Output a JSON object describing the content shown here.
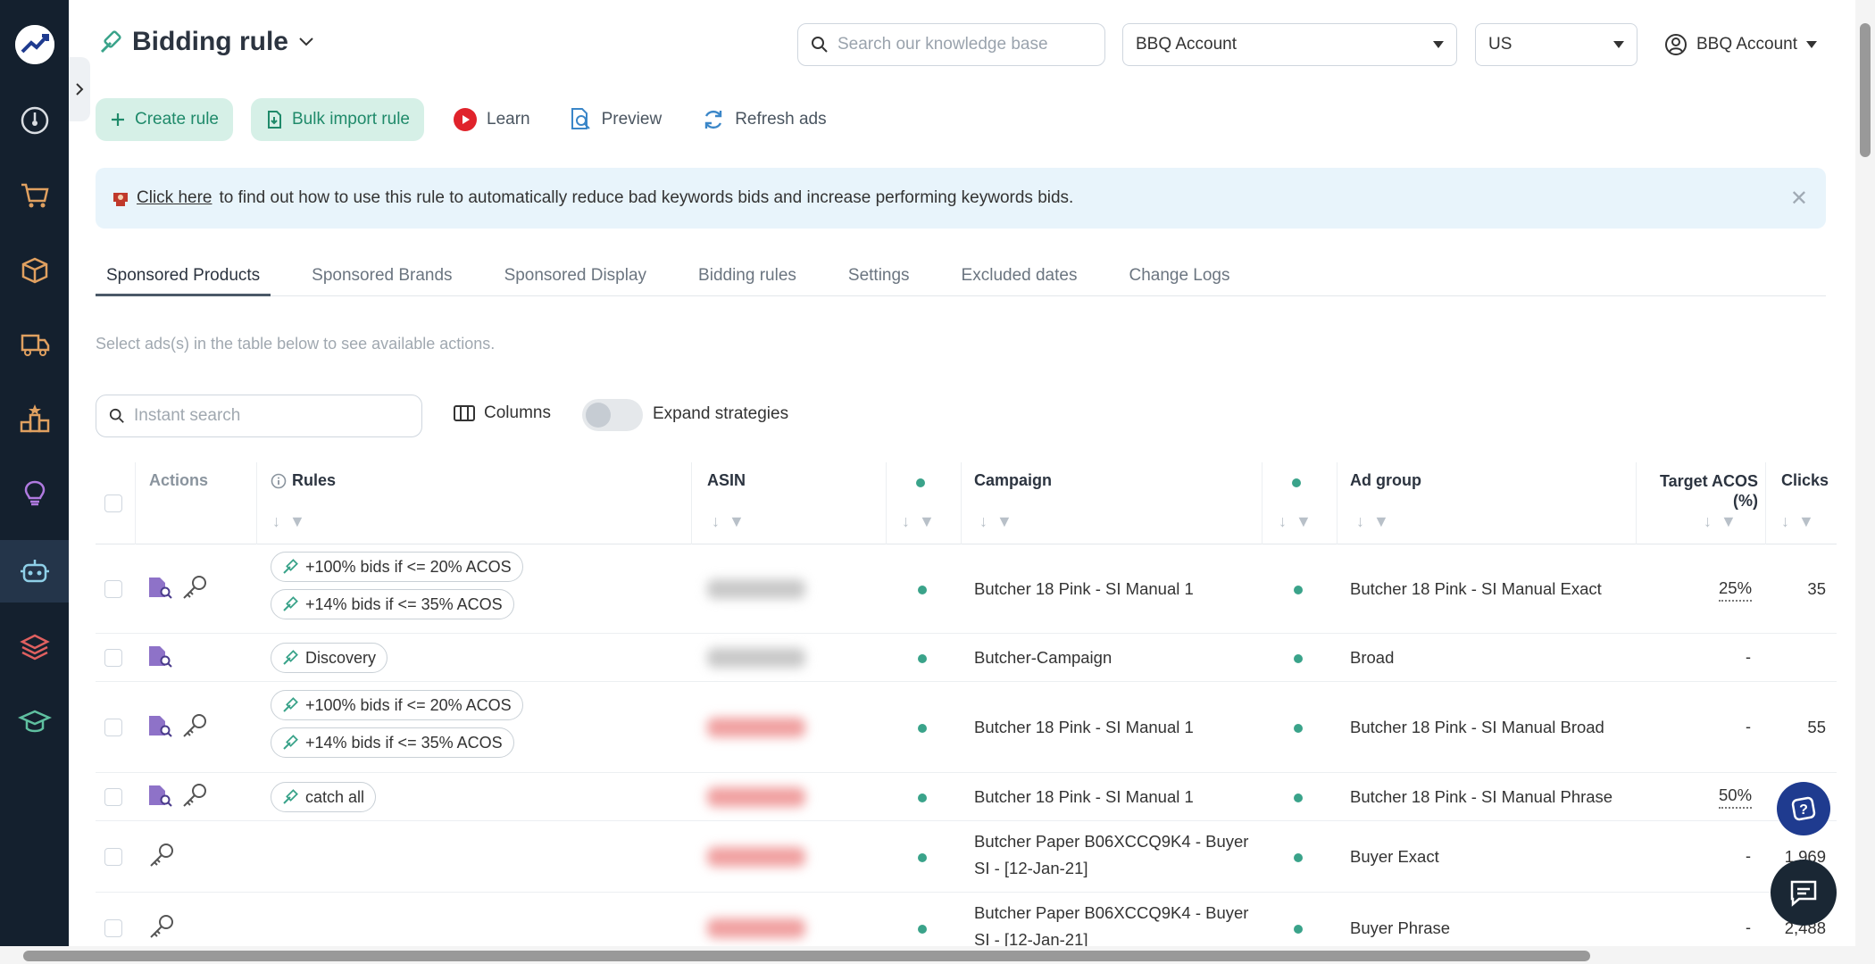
{
  "header": {
    "title": "Bidding rule",
    "kb_search_placeholder": "Search our knowledge base",
    "account_select": "BBQ Account",
    "region_select": "US",
    "account_menu": "BBQ Account"
  },
  "toolbar": {
    "create_rule": "Create rule",
    "bulk_import": "Bulk import rule",
    "learn": "Learn",
    "preview": "Preview",
    "refresh": "Refresh ads"
  },
  "banner": {
    "link_text": "Click here",
    "text": "to find out how to use this rule to automatically reduce bad keywords bids and increase performing keywords bids."
  },
  "tabs": [
    "Sponsored Products",
    "Sponsored Brands",
    "Sponsored Display",
    "Bidding rules",
    "Settings",
    "Excluded dates",
    "Change Logs"
  ],
  "hint": "Select ads(s) in the table below to see available actions.",
  "filter": {
    "instant_search_placeholder": "Instant search",
    "columns": "Columns",
    "expand_strategies": "Expand strategies"
  },
  "table": {
    "headers": {
      "actions": "Actions",
      "rules": "Rules",
      "asin": "ASIN",
      "campaign": "Campaign",
      "ad_group": "Ad group",
      "target_acos": "Target ACOS (%)",
      "clicks": "Clicks"
    },
    "rows": [
      {
        "rules": [
          "+100% bids if <= 20% ACOS",
          "+14% bids if <= 35% ACOS"
        ],
        "campaign": "Butcher 18 Pink - SI Manual 1",
        "ad_group": "Butcher 18 Pink - SI Manual Exact",
        "acos": "25%",
        "clicks": "35"
      },
      {
        "rules": [
          "Discovery"
        ],
        "campaign": "Butcher-Campaign",
        "ad_group": "Broad",
        "acos": "-",
        "clicks": ""
      },
      {
        "rules": [
          "+100% bids if <= 20% ACOS",
          "+14% bids if <= 35% ACOS"
        ],
        "campaign": "Butcher 18 Pink - SI Manual 1",
        "ad_group": "Butcher 18 Pink - SI Manual Broad",
        "acos": "-",
        "clicks": "55"
      },
      {
        "rules": [
          "catch all"
        ],
        "campaign": "Butcher 18 Pink - SI Manual 1",
        "ad_group": "Butcher 18 Pink - SI Manual Phrase",
        "acos": "50%",
        "clicks": ""
      },
      {
        "rules": [],
        "campaign_l1": "Butcher Paper B06XCCQ9K4 - Buyer",
        "campaign_l2": "SI - [12-Jan-21]",
        "ad_group": "Buyer Exact",
        "acos": "-",
        "clicks": "1,969"
      },
      {
        "rules": [],
        "campaign_l1": "Butcher Paper B06XCCQ9K4 - Buyer",
        "campaign_l2": "SI - [12-Jan-21]",
        "ad_group": "Buyer Phrase",
        "acos": "-",
        "clicks": "2,488"
      }
    ]
  }
}
